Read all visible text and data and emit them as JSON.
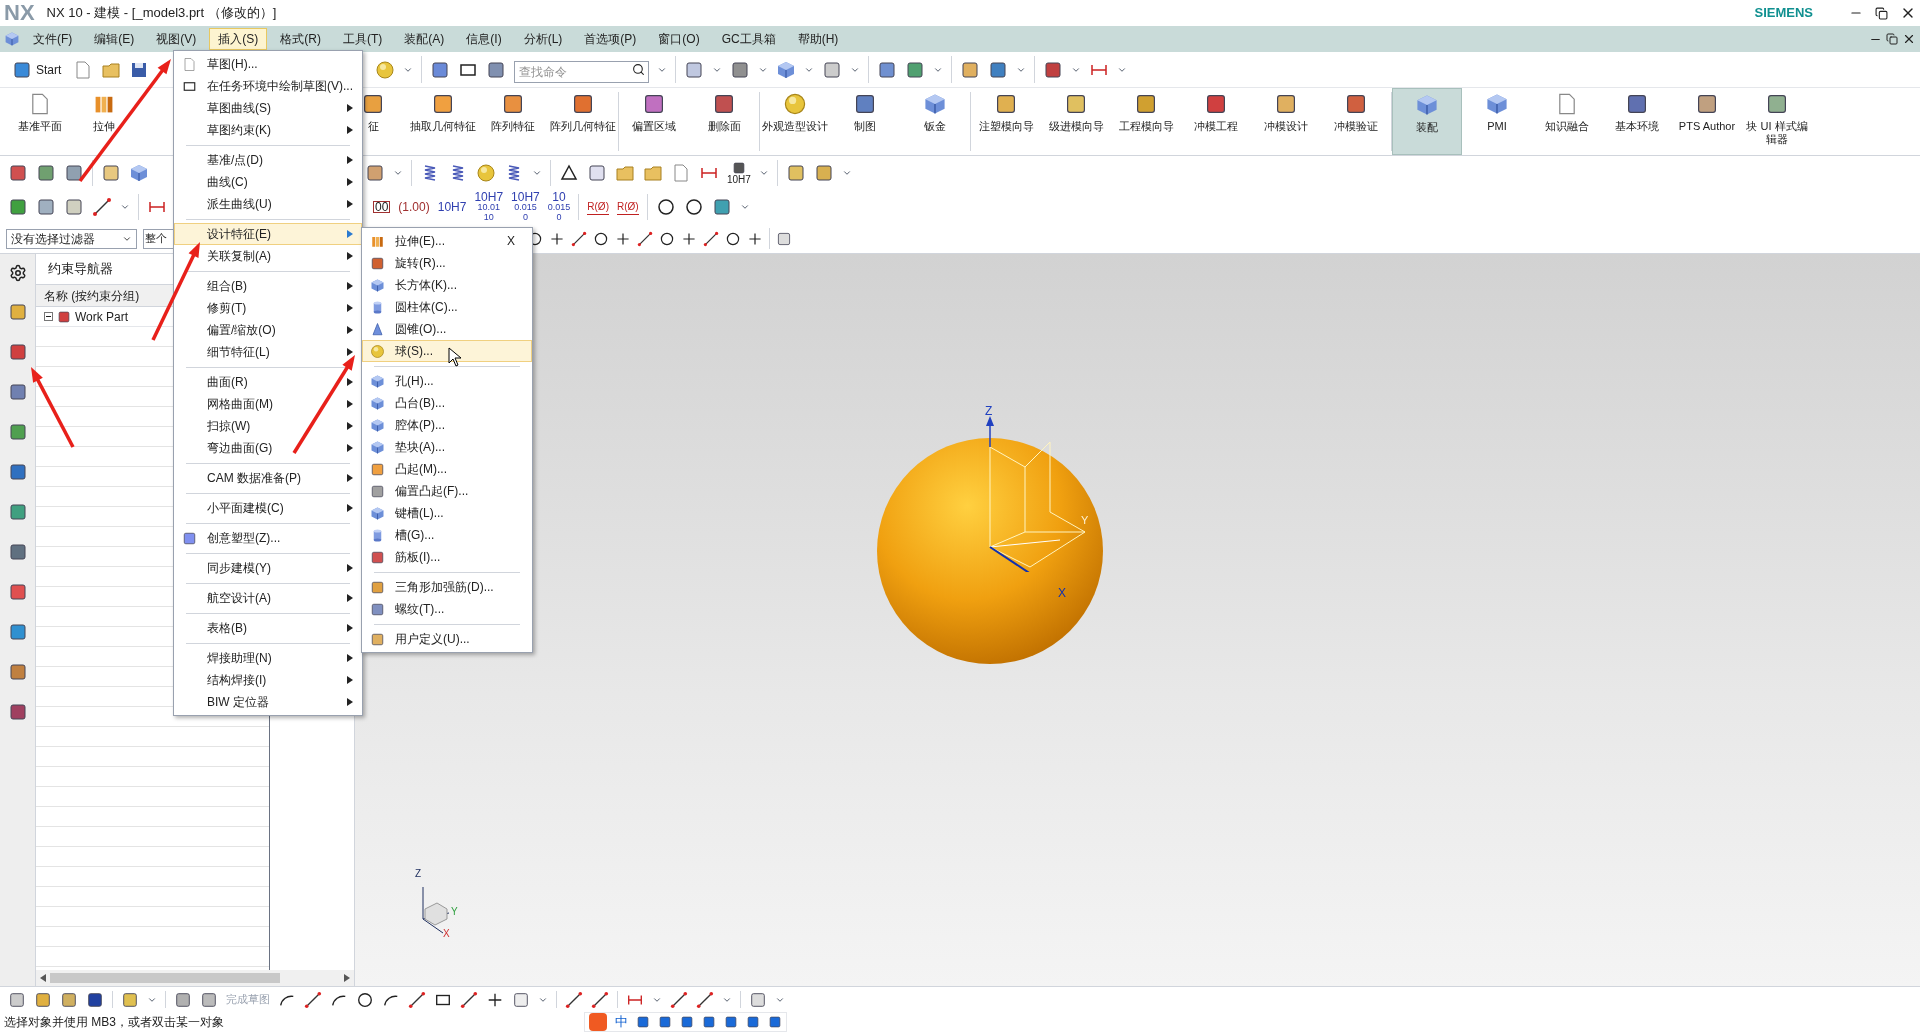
{
  "window": {
    "logo": "NX",
    "title": "NX 10 - 建模 - [_model3.prt （修改的）]",
    "brand": "SIEMENS"
  },
  "menu_bar": [
    {
      "label": "文件(F)",
      "selected": false
    },
    {
      "label": "编辑(E)",
      "selected": false
    },
    {
      "label": "视图(V)",
      "selected": false
    },
    {
      "label": "插入(S)",
      "selected": true
    },
    {
      "label": "格式(R)",
      "selected": false
    },
    {
      "label": "工具(T)",
      "selected": false
    },
    {
      "label": "装配(A)",
      "selected": false
    },
    {
      "label": "信息(I)",
      "selected": false
    },
    {
      "label": "分析(L)",
      "selected": false
    },
    {
      "label": "首选项(P)",
      "selected": false
    },
    {
      "label": "窗口(O)",
      "selected": false
    },
    {
      "label": "GC工具箱",
      "selected": false
    },
    {
      "label": "帮助(H)",
      "selected": false
    }
  ],
  "toolbar": {
    "start": "Start",
    "search_placeholder": "查找命令"
  },
  "ribbon": [
    {
      "label": "基准平面",
      "selected": false
    },
    {
      "label": "拉伸",
      "selected": false
    },
    {
      "label": "征",
      "selected": false
    },
    {
      "label": "抽取几何特征",
      "selected": false
    },
    {
      "label": "阵列特征",
      "selected": false
    },
    {
      "label": "阵列几何特征",
      "selected": false
    },
    {
      "label": "偏置区域",
      "selected": false
    },
    {
      "label": "删除面",
      "selected": false
    },
    {
      "label": "外观造型设计",
      "selected": false
    },
    {
      "label": "制图",
      "selected": false
    },
    {
      "label": "钣金",
      "selected": false
    },
    {
      "label": "注塑模向导",
      "selected": false
    },
    {
      "label": "级进模向导",
      "selected": false
    },
    {
      "label": "工程模向导",
      "selected": false
    },
    {
      "label": "冲模工程",
      "selected": false
    },
    {
      "label": "冲模设计",
      "selected": false
    },
    {
      "label": "冲模验证",
      "selected": false
    },
    {
      "label": "装配",
      "selected": true
    },
    {
      "label": "PMI",
      "selected": false
    },
    {
      "label": "知识融合",
      "selected": false
    },
    {
      "label": "基本环境",
      "selected": false
    },
    {
      "label": "PTS Author",
      "selected": false
    },
    {
      "label": "块 UI 样式编辑器",
      "selected": false
    }
  ],
  "toolbar_row2": {
    "fit_label": "10H7"
  },
  "dimension_styles": [
    {
      "main": "00"
    },
    {
      "main": "(1.00)"
    },
    {
      "main": "10H7"
    },
    {
      "main": "10H7",
      "sub": [
        "10.01",
        "10"
      ]
    },
    {
      "main": "10H7",
      "sub": [
        "0.015",
        "0"
      ]
    },
    {
      "main": "10",
      "sub": [
        "0.015",
        "0"
      ]
    }
  ],
  "radius_labels": [
    "R(Ø)",
    "R(Ø)"
  ],
  "selection_bar": {
    "filter": "没有选择过滤器",
    "scope": "整个"
  },
  "navigator": {
    "title": "约束导航器",
    "column": "名称 (按约束分组)",
    "tree": [
      {
        "label": "Work Part",
        "expanded": true
      }
    ]
  },
  "insert_menu": [
    {
      "kind": "command",
      "label": "草图(H)...",
      "selected": false
    },
    {
      "kind": "command",
      "label": "在任务环境中绘制草图(V)...",
      "selected": false
    },
    {
      "kind": "submenu",
      "label": "草图曲线(S)",
      "selected": false
    },
    {
      "kind": "submenu",
      "label": "草图约束(K)",
      "selected": false
    },
    {
      "kind": "separator"
    },
    {
      "kind": "submenu",
      "label": "基准/点(D)",
      "selected": false
    },
    {
      "kind": "submenu",
      "label": "曲线(C)",
      "selected": false
    },
    {
      "kind": "submenu",
      "label": "派生曲线(U)",
      "selected": false
    },
    {
      "kind": "separator"
    },
    {
      "kind": "submenu",
      "label": "设计特征(E)",
      "selected": true
    },
    {
      "kind": "submenu",
      "label": "关联复制(A)",
      "selected": false
    },
    {
      "kind": "separator"
    },
    {
      "kind": "submenu",
      "label": "组合(B)",
      "selected": false
    },
    {
      "kind": "submenu",
      "label": "修剪(T)",
      "selected": false
    },
    {
      "kind": "submenu",
      "label": "偏置/缩放(O)",
      "selected": false
    },
    {
      "kind": "submenu",
      "label": "细节特征(L)",
      "selected": false
    },
    {
      "kind": "separator"
    },
    {
      "kind": "submenu",
      "label": "曲面(R)",
      "selected": false
    },
    {
      "kind": "submenu",
      "label": "网格曲面(M)",
      "selected": false
    },
    {
      "kind": "submenu",
      "label": "扫掠(W)",
      "selected": false
    },
    {
      "kind": "submenu",
      "label": "弯边曲面(G)",
      "selected": false
    },
    {
      "kind": "separator"
    },
    {
      "kind": "submenu",
      "label": "CAM 数据准备(P)",
      "selected": false
    },
    {
      "kind": "separator"
    },
    {
      "kind": "submenu",
      "label": "小平面建模(C)",
      "selected": false
    },
    {
      "kind": "separator"
    },
    {
      "kind": "command",
      "label": "创意塑型(Z)...",
      "selected": false
    },
    {
      "kind": "separator"
    },
    {
      "kind": "submenu",
      "label": "同步建模(Y)",
      "selected": false
    },
    {
      "kind": "separator"
    },
    {
      "kind": "submenu",
      "label": "航空设计(A)",
      "selected": false
    },
    {
      "kind": "separator"
    },
    {
      "kind": "submenu",
      "label": "表格(B)",
      "selected": false
    },
    {
      "kind": "separator"
    },
    {
      "kind": "submenu",
      "label": "焊接助理(N)",
      "selected": false
    },
    {
      "kind": "submenu",
      "label": "结构焊接(I)",
      "selected": false
    },
    {
      "kind": "submenu",
      "label": "BIW 定位器",
      "selected": false
    }
  ],
  "design_feature_menu": [
    {
      "kind": "command",
      "label": "拉伸(E)...",
      "shortcut": "X",
      "selected": false
    },
    {
      "kind": "command",
      "label": "旋转(R)...",
      "selected": false
    },
    {
      "kind": "command",
      "label": "长方体(K)...",
      "selected": false
    },
    {
      "kind": "command",
      "label": "圆柱体(C)...",
      "selected": false
    },
    {
      "kind": "command",
      "label": "圆锥(O)...",
      "selected": false
    },
    {
      "kind": "command",
      "label": "球(S)...",
      "selected": true
    },
    {
      "kind": "separator"
    },
    {
      "kind": "command",
      "label": "孔(H)...",
      "selected": false
    },
    {
      "kind": "command",
      "label": "凸台(B)...",
      "selected": false
    },
    {
      "kind": "command",
      "label": "腔体(P)...",
      "selected": false
    },
    {
      "kind": "command",
      "label": "垫块(A)...",
      "selected": false
    },
    {
      "kind": "command",
      "label": "凸起(M)...",
      "selected": false
    },
    {
      "kind": "command",
      "label": "偏置凸起(F)...",
      "selected": false
    },
    {
      "kind": "command",
      "label": "键槽(L)...",
      "selected": false
    },
    {
      "kind": "command",
      "label": "槽(G)...",
      "selected": false
    },
    {
      "kind": "command",
      "label": "筋板(I)...",
      "selected": false
    },
    {
      "kind": "separator"
    },
    {
      "kind": "command",
      "label": "三角形加强筋(D)...",
      "selected": false
    },
    {
      "kind": "command",
      "label": "螺纹(T)...",
      "selected": false
    },
    {
      "kind": "separator"
    },
    {
      "kind": "command",
      "label": "用户定义(U)...",
      "selected": false
    }
  ],
  "viewport": {
    "axis_labels": [
      "Z",
      "Y",
      "X"
    ],
    "triad_labels": [
      "Z",
      "Y",
      "X"
    ]
  },
  "bottom_toolbar": {
    "finish_sketch": "完成草图"
  },
  "status_bar": "选择对象并使用 MB3，或者双击某一对象",
  "ime_bar": {
    "mode": "中"
  }
}
